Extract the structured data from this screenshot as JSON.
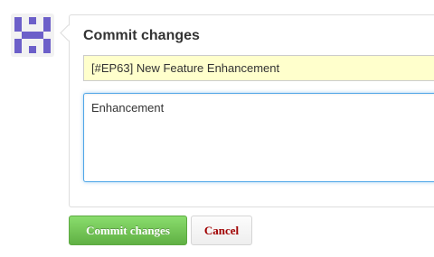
{
  "form": {
    "title": "Commit changes",
    "summary_value": "[#EP63] New Feature Enhancement",
    "description_value": "Enhancement"
  },
  "avatar": {
    "icon": "identicon-avatar",
    "color": "#6c5fc9"
  },
  "buttons": {
    "commit_label": "Commit changes",
    "cancel_label": "Cancel"
  },
  "colors": {
    "commit_green": "#60b044",
    "cancel_red": "#a00000",
    "summary_bg": "#ffffcc",
    "focus_blue": "#51a7e8"
  }
}
